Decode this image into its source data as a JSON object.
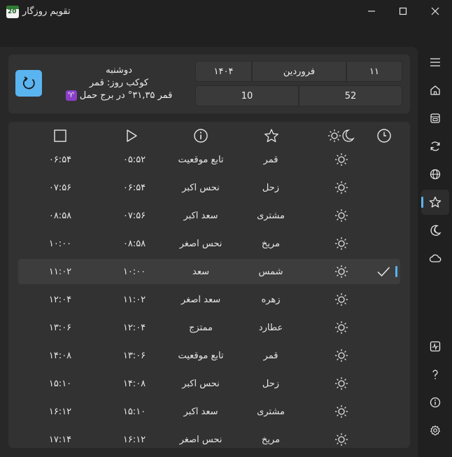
{
  "window": {
    "title": "تقویم روزگار",
    "app_icon_text": "20"
  },
  "summary": {
    "weekday": "دوشنبه",
    "day_planet": "کوکب روز: قمر",
    "moon_position": "قمر ۳۱,۳۵° در برج حمل",
    "zodiac_symbol": "♈",
    "day": "۱۱",
    "month": "فروردین",
    "year": "۱۴۰۴",
    "hour": "10",
    "minute": "52"
  },
  "table": {
    "rows": [
      {
        "planet": "قمر",
        "quality": "تابع موقعیت",
        "start": "۰۵:۵۲",
        "end": "۰۶:۵۴",
        "active": false
      },
      {
        "planet": "زحل",
        "quality": "نحس اکبر",
        "start": "۰۶:۵۴",
        "end": "۰۷:۵۶",
        "active": false
      },
      {
        "planet": "مشتری",
        "quality": "سعد اکبر",
        "start": "۰۷:۵۶",
        "end": "۰۸:۵۸",
        "active": false
      },
      {
        "planet": "مریخ",
        "quality": "نحس اصغر",
        "start": "۰۸:۵۸",
        "end": "۱۰:۰۰",
        "active": false
      },
      {
        "planet": "شمس",
        "quality": "سعد",
        "start": "۱۰:۰۰",
        "end": "۱۱:۰۲",
        "active": true
      },
      {
        "planet": "زهره",
        "quality": "سعد اصغر",
        "start": "۱۱:۰۲",
        "end": "۱۲:۰۴",
        "active": false
      },
      {
        "planet": "عطارد",
        "quality": "ممتزج",
        "start": "۱۲:۰۴",
        "end": "۱۳:۰۶",
        "active": false
      },
      {
        "planet": "قمر",
        "quality": "تابع موقعیت",
        "start": "۱۳:۰۶",
        "end": "۱۴:۰۸",
        "active": false
      },
      {
        "planet": "زحل",
        "quality": "نحس اکبر",
        "start": "۱۴:۰۸",
        "end": "۱۵:۱۰",
        "active": false
      },
      {
        "planet": "مشتری",
        "quality": "سعد اکبر",
        "start": "۱۵:۱۰",
        "end": "۱۶:۱۲",
        "active": false
      },
      {
        "planet": "مریخ",
        "quality": "نحس اصغر",
        "start": "۱۶:۱۲",
        "end": "۱۷:۱۴",
        "active": false
      }
    ]
  },
  "icons": {
    "header": [
      "clock-icon",
      "day-night-icon",
      "star-icon",
      "info-icon",
      "play-icon",
      "stop-icon"
    ],
    "nav": [
      "menu-icon",
      "home-icon",
      "calendar-icon",
      "sync-icon",
      "globe-icon",
      "star-icon",
      "moon-icon",
      "cloud-icon",
      "pulse-icon",
      "help-icon",
      "info-icon",
      "settings-icon"
    ]
  },
  "colors": {
    "accent": "#5ab4f0",
    "background": "#202020",
    "panel": "#282828",
    "card": "#323232",
    "aries_badge": "#8a3fc7"
  }
}
